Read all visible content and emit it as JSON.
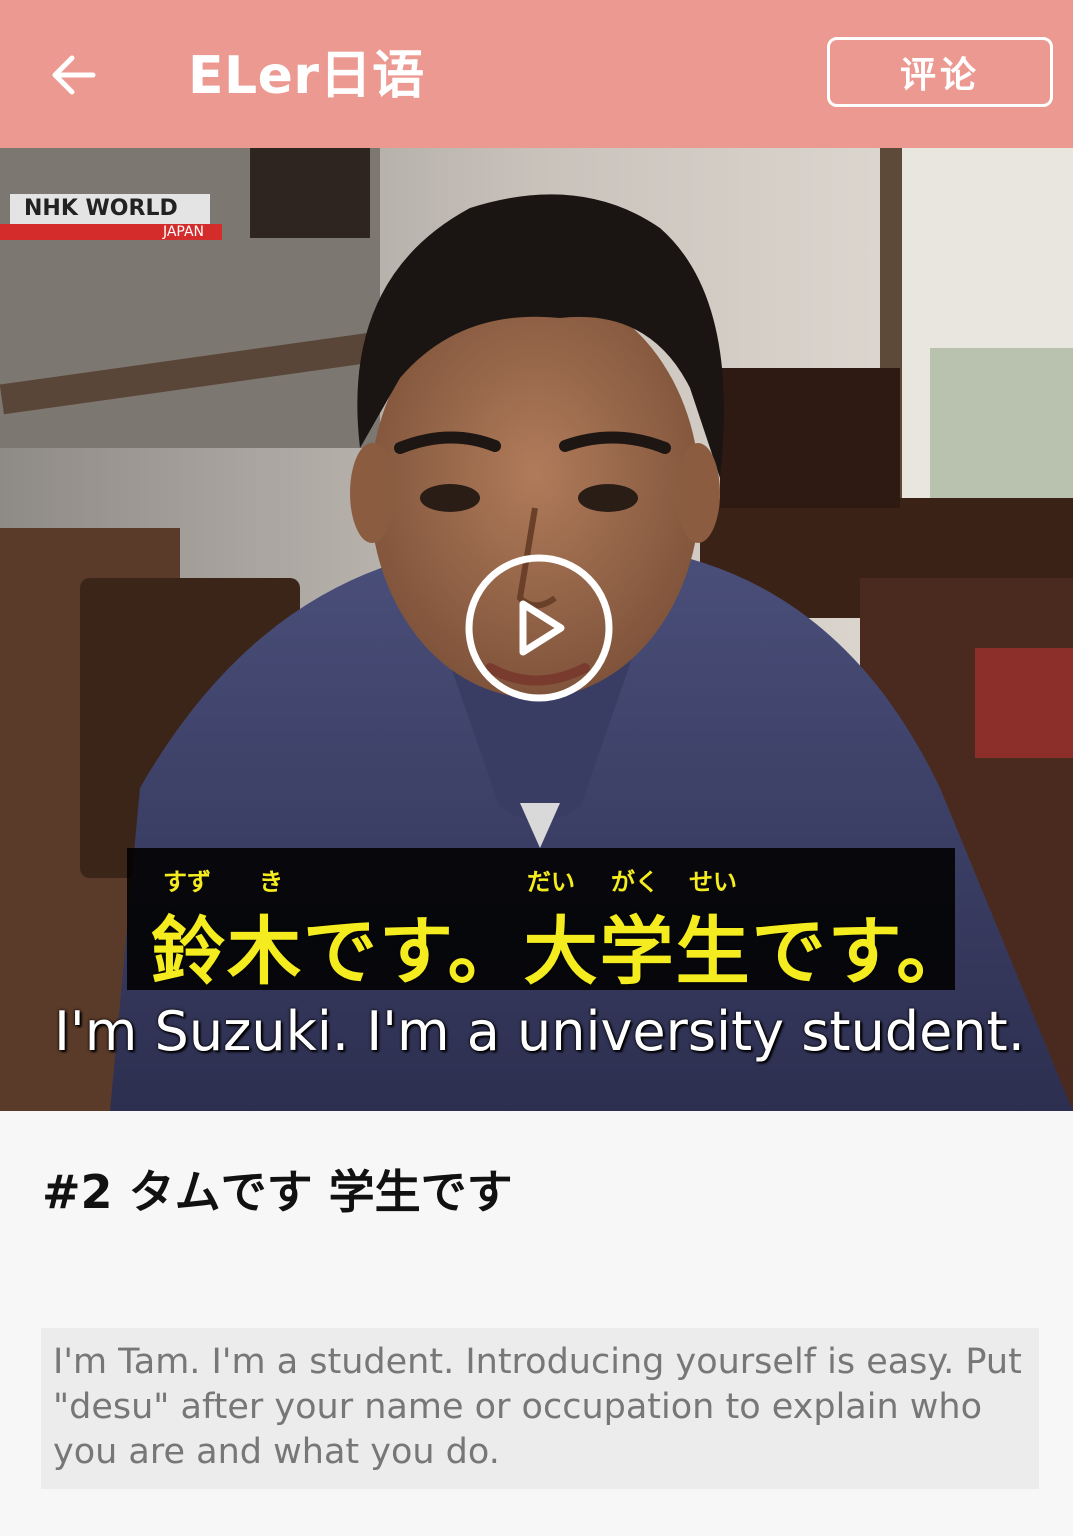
{
  "header": {
    "title": "ELer日语",
    "comment_label": "评论",
    "background_color": "#ec9a91",
    "back_icon": "arrow-left-icon"
  },
  "video": {
    "channel_logo": {
      "main": "NHK WORLD",
      "sub": "JAPAN"
    },
    "subtitle_jp": {
      "text": "鈴木です。大学生です。",
      "furigana": [
        "すず",
        "き",
        "だい",
        "がく",
        "せい"
      ]
    },
    "subtitle_en": "I'm Suzuki. I'm a university student.",
    "play_icon": "play-circle-icon"
  },
  "episode": {
    "title": "#2 タムです 学生です",
    "description": "I'm Tam. I'm a student. Introducing yourself is easy. Put \"desu\" after your name or occupation to explain who you are and what you do."
  }
}
